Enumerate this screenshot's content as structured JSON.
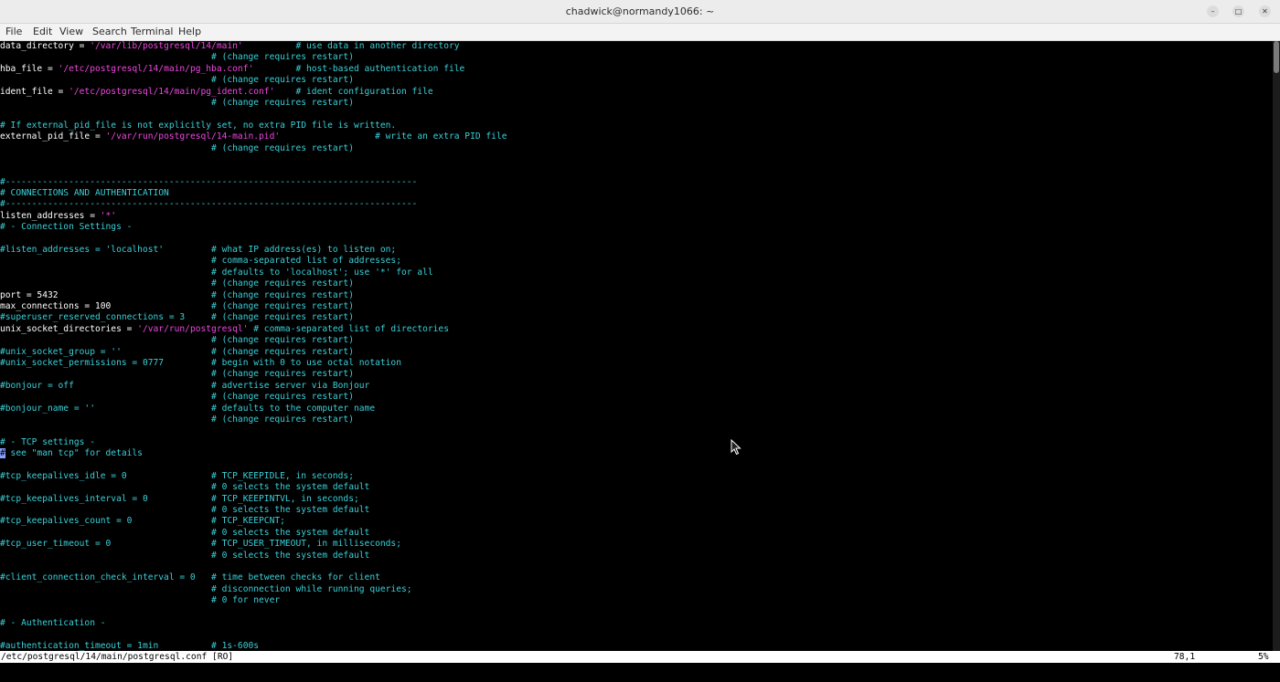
{
  "window": {
    "title": "chadwick@normandy1066: ~",
    "minimize_icon": "minimize-icon",
    "maximize_icon": "maximize-icon",
    "close_icon": "close-icon"
  },
  "menu": [
    {
      "label": "File"
    },
    {
      "label": "Edit"
    },
    {
      "label": "View"
    },
    {
      "label": "Search"
    },
    {
      "label": "Terminal"
    },
    {
      "label": "Help"
    }
  ],
  "lines": [
    {
      "t": "data_directory = ",
      "str": "'/var/lib/postgresql/14/main'",
      "cm": "          # use data in another directory"
    },
    {
      "cm": "                                        # (change requires restart)"
    },
    {
      "t": "hba_file = ",
      "str": "'/etc/postgresql/14/main/pg_hba.conf'",
      "cm": "        # host-based authentication file"
    },
    {
      "cm": "                                        # (change requires restart)"
    },
    {
      "t": "ident_file = ",
      "str": "'/etc/postgresql/14/main/pg_ident.conf'",
      "cm": "    # ident configuration file"
    },
    {
      "cm": "                                        # (change requires restart)"
    },
    {},
    {
      "cm": "# If external_pid_file is not explicitly set, no extra PID file is written."
    },
    {
      "t": "external_pid_file = ",
      "str": "'/var/run/postgresql/14-main.pid'",
      "cm": "                  # write an extra PID file"
    },
    {
      "cm": "                                        # (change requires restart)"
    },
    {},
    {},
    {
      "cm": "#------------------------------------------------------------------------------"
    },
    {
      "cm": "# CONNECTIONS AND AUTHENTICATION"
    },
    {
      "cm": "#------------------------------------------------------------------------------"
    },
    {
      "t": "listen_addresses = ",
      "str": "'*'"
    },
    {
      "cm": "# - Connection Settings -"
    },
    {},
    {
      "cm": "#listen_addresses = 'localhost'         # what IP address(es) to listen on;"
    },
    {
      "cm": "                                        # comma-separated list of addresses;"
    },
    {
      "cm": "                                        # defaults to 'localhost'; use '*' for all"
    },
    {
      "cm": "                                        # (change requires restart)"
    },
    {
      "t": "port = 5432                             ",
      "cm": "# (change requires restart)"
    },
    {
      "t": "max_connections = 100                   ",
      "cm": "# (change requires restart)"
    },
    {
      "cm": "#superuser_reserved_connections = 3     # (change requires restart)"
    },
    {
      "t": "unix_socket_directories = ",
      "str": "'/var/run/postgresql'",
      "cm": " # comma-separated list of directories"
    },
    {
      "cm": "                                        # (change requires restart)"
    },
    {
      "cm": "#unix_socket_group = ''                 # (change requires restart)"
    },
    {
      "cm": "#unix_socket_permissions = 0777         # begin with 0 to use octal notation"
    },
    {
      "cm": "                                        # (change requires restart)"
    },
    {
      "cm": "#bonjour = off                          # advertise server via Bonjour"
    },
    {
      "cm": "                                        # (change requires restart)"
    },
    {
      "cm": "#bonjour_name = ''                      # defaults to the computer name"
    },
    {
      "cm": "                                        # (change requires restart)"
    },
    {},
    {
      "cm": "# - TCP settings -"
    },
    {
      "cur": "#",
      "cm": " see \"man tcp\" for details"
    },
    {},
    {
      "cm": "#tcp_keepalives_idle = 0                # TCP_KEEPIDLE, in seconds;"
    },
    {
      "cm": "                                        # 0 selects the system default"
    },
    {
      "cm": "#tcp_keepalives_interval = 0            # TCP_KEEPINTVL, in seconds;"
    },
    {
      "cm": "                                        # 0 selects the system default"
    },
    {
      "cm": "#tcp_keepalives_count = 0               # TCP_KEEPCNT;"
    },
    {
      "cm": "                                        # 0 selects the system default"
    },
    {
      "cm": "#tcp_user_timeout = 0                   # TCP_USER_TIMEOUT, in milliseconds;"
    },
    {
      "cm": "                                        # 0 selects the system default"
    },
    {},
    {
      "cm": "#client_connection_check_interval = 0   # time between checks for client"
    },
    {
      "cm": "                                        # disconnection while running queries;"
    },
    {
      "cm": "                                        # 0 for never"
    },
    {},
    {
      "cm": "# - Authentication -"
    },
    {},
    {
      "cm": "#authentication_timeout = 1min          # 1s-600s"
    }
  ],
  "status": {
    "file": "/etc/postgresql/14/main/postgresql.conf [RO]",
    "position": "78,1",
    "percent": "5%"
  }
}
